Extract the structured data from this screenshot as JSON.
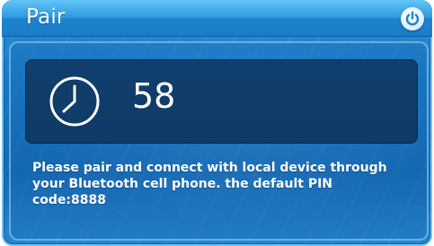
{
  "window": {
    "title": "Pair",
    "close_icon": "power-icon"
  },
  "timer": {
    "icon": "clock-icon",
    "countdown": "58"
  },
  "message": {
    "lines": [
      "Please pair and connect with local device through",
      "your Bluetooth cell phone. the default PIN",
      "code:8888"
    ]
  },
  "colors": {
    "accent": "#1a78c4",
    "panel": "#113f6d",
    "text": "#ffffff"
  }
}
